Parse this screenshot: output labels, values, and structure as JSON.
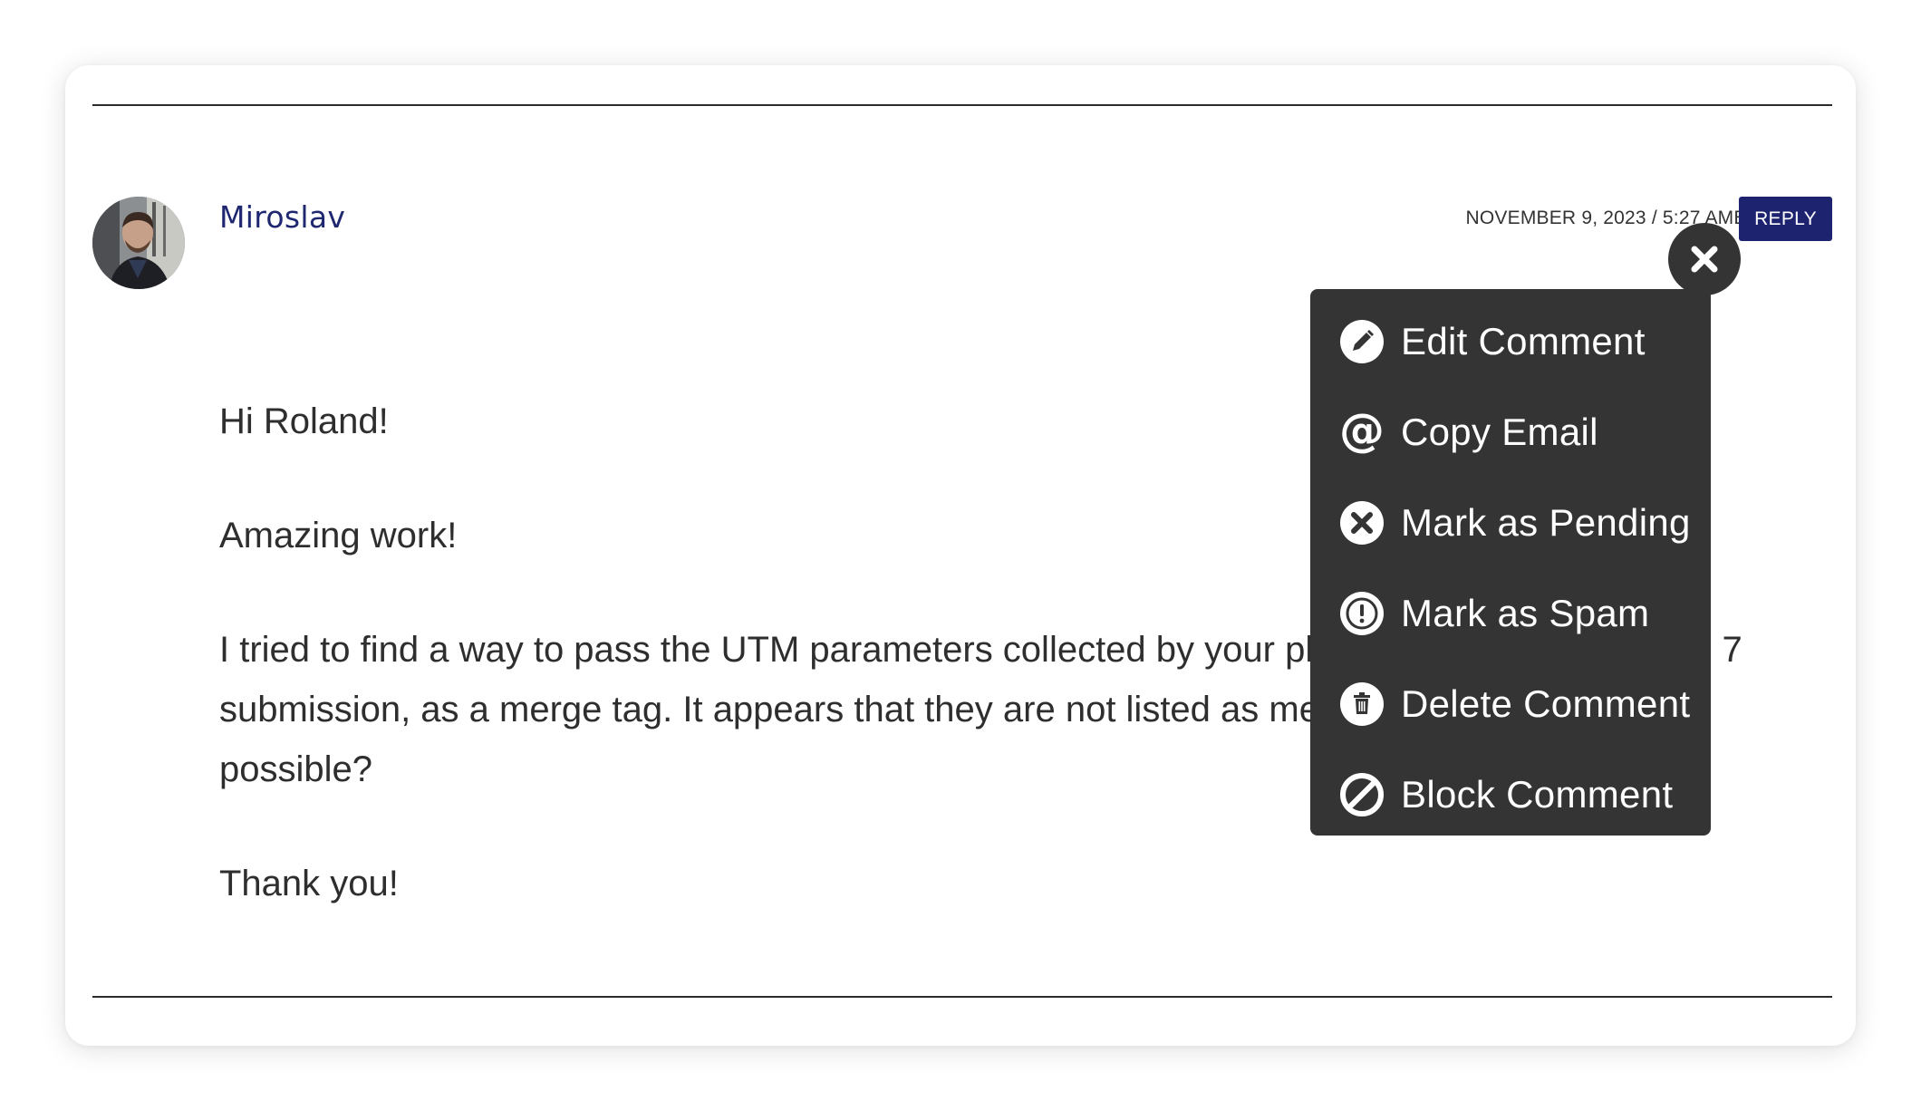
{
  "comment": {
    "author": "Miroslav",
    "meta": "NOVEMBER 9, 2023 / 5:27 AMEDIT",
    "reply_label": "REPLY",
    "paragraphs": [
      "Hi Roland!",
      "Amazing work!",
      "I tried to find a way to pass the UTM parameters collected by your plugin to the Contact Form 7 submission, as a merge tag. It appears that they are not listed as merge tags. Would this be possible?",
      "Thank you!"
    ]
  },
  "menu": {
    "items": [
      {
        "label": "Edit Comment",
        "icon": "pencil-icon"
      },
      {
        "label": "Copy Email",
        "icon": "at-icon"
      },
      {
        "label": "Mark as Pending",
        "icon": "x-circle-icon"
      },
      {
        "label": "Mark as Spam",
        "icon": "exclamation-circle-icon"
      },
      {
        "label": "Delete Comment",
        "icon": "trash-icon"
      },
      {
        "label": "Block Comment",
        "icon": "ban-icon"
      }
    ]
  },
  "close_icon": "close-icon"
}
